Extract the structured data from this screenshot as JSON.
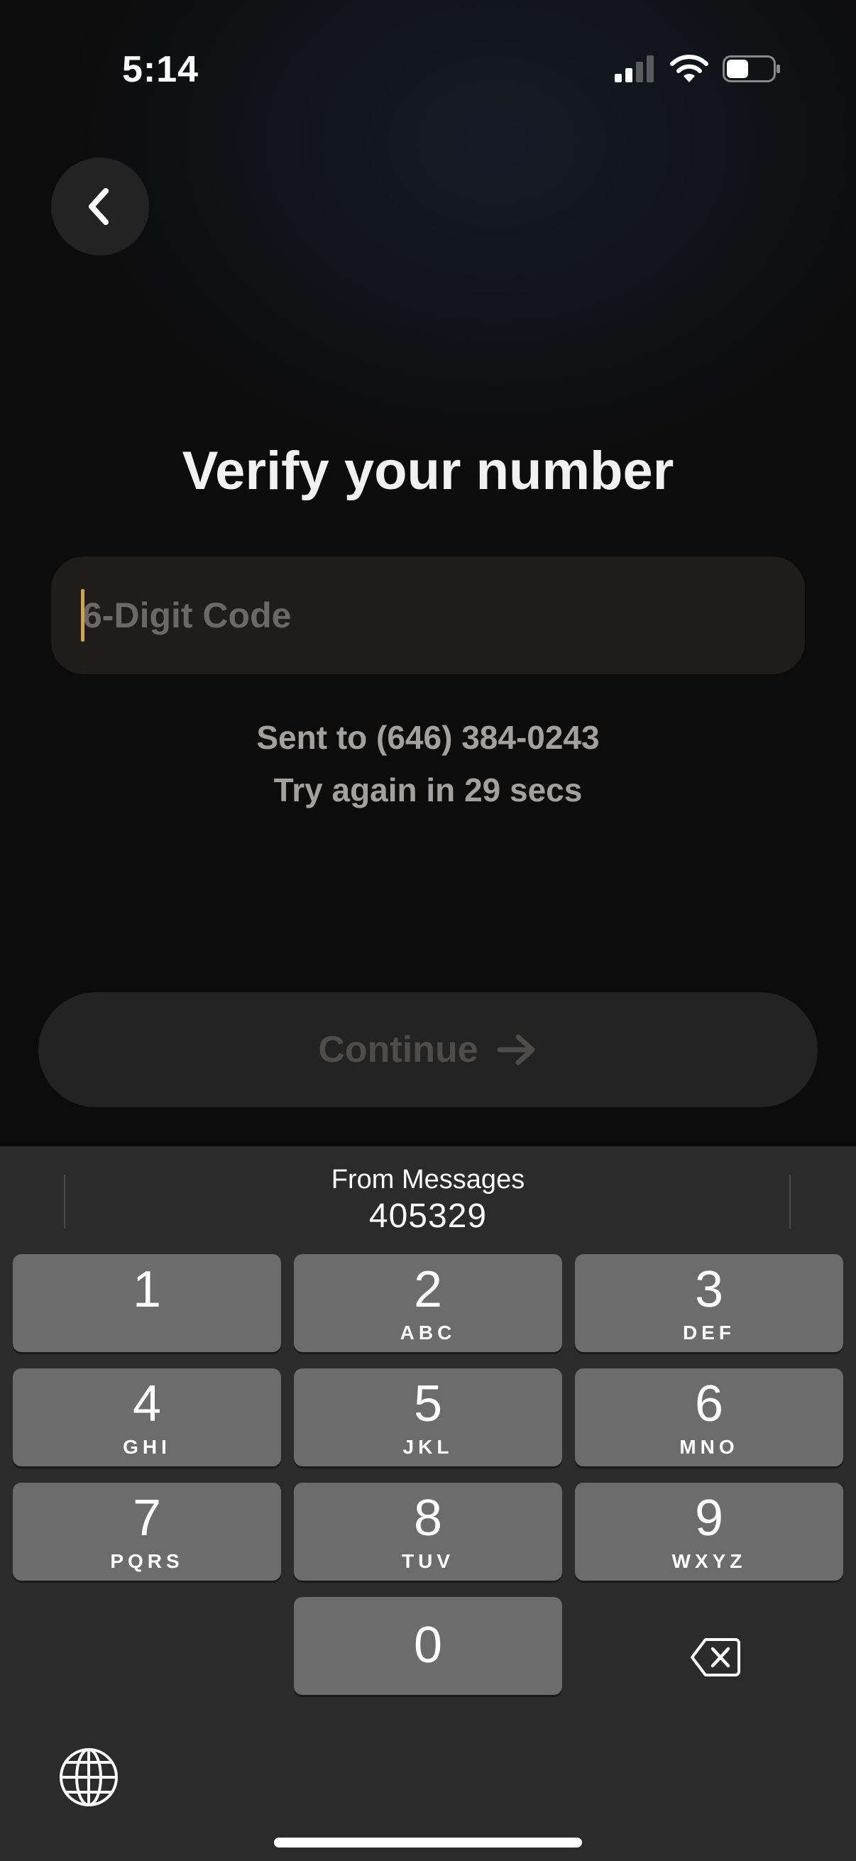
{
  "status_bar": {
    "time": "5:14",
    "icons": [
      "signal-icon",
      "wifi-icon",
      "battery-icon"
    ]
  },
  "nav": {
    "back_icon": "chevron-left-icon"
  },
  "title": "Verify your number",
  "code_field": {
    "placeholder": "6-Digit Code",
    "value": ""
  },
  "sent_text": "Sent to (646) 384-0243",
  "retry_text": "Try again in 29 secs",
  "continue_button": {
    "label": "Continue",
    "icon": "arrow-right-icon",
    "enabled": false
  },
  "keyboard": {
    "suggestion": {
      "label": "From Messages",
      "code": "405329"
    },
    "keys": [
      {
        "digit": "1",
        "letters": ""
      },
      {
        "digit": "2",
        "letters": "ABC"
      },
      {
        "digit": "3",
        "letters": "DEF"
      },
      {
        "digit": "4",
        "letters": "GHI"
      },
      {
        "digit": "5",
        "letters": "JKL"
      },
      {
        "digit": "6",
        "letters": "MNO"
      },
      {
        "digit": "7",
        "letters": "PQRS"
      },
      {
        "digit": "8",
        "letters": "TUV"
      },
      {
        "digit": "9",
        "letters": "WXYZ"
      },
      {
        "digit": "0",
        "letters": ""
      }
    ],
    "delete_icon": "delete-backspace-icon",
    "globe_icon": "globe-icon"
  },
  "colors": {
    "background": "#0d0c0c",
    "field": "#1f1d1c",
    "caret": "#c9a55a",
    "button_disabled": "#232323",
    "keyboard_bg": "#2b2b2b",
    "key_bg": "#6c6c6c"
  }
}
